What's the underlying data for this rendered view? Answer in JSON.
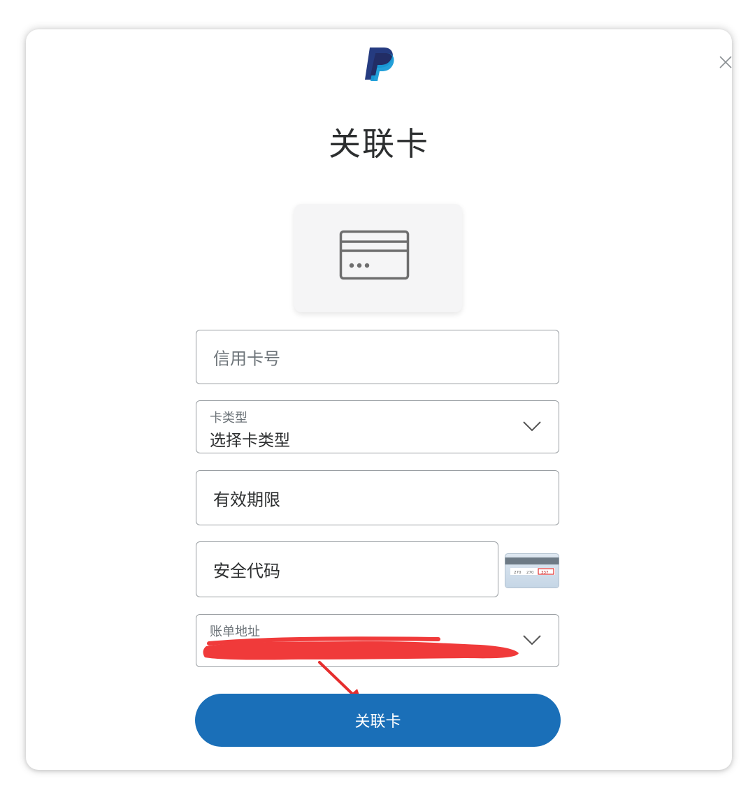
{
  "dialog": {
    "title": "关联卡",
    "close_icon": "close-icon",
    "logo_icon": "paypal-logo",
    "card_icon": "credit-card-icon"
  },
  "form": {
    "card_number": {
      "placeholder": "信用卡号"
    },
    "card_type": {
      "label": "卡类型",
      "value": "选择卡类型",
      "icon": "chevron-down-icon"
    },
    "expiry": {
      "placeholder": "有效期限"
    },
    "security_code": {
      "placeholder": "安全代码",
      "hint_icon": "cvv-card-icon",
      "hint_digits": [
        "270",
        "270",
        "337"
      ]
    },
    "billing_address": {
      "label": "账单地址",
      "icon": "chevron-down-icon"
    }
  },
  "submit": {
    "label": "关联卡"
  },
  "colors": {
    "accent": "#1a6fb8",
    "paypal_dark": "#253b80",
    "paypal_light": "#179bd7",
    "redaction": "#f03a3a"
  }
}
